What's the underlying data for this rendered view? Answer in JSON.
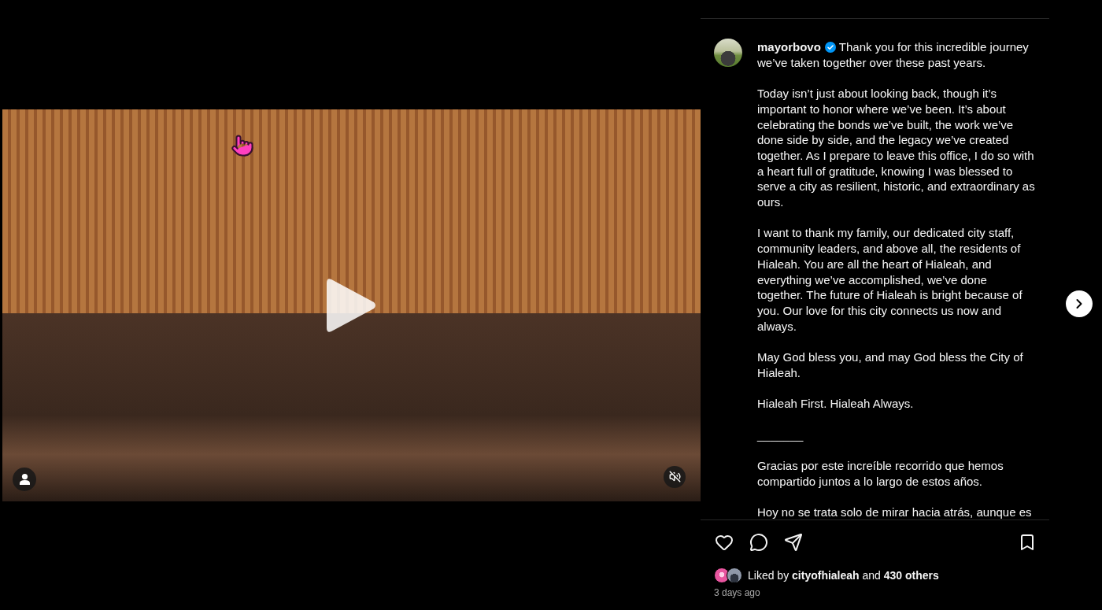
{
  "video": {
    "paused": true,
    "muted": true
  },
  "caption": {
    "username": "mayorbovo",
    "verified": true,
    "paragraphs": [
      "Thank you for this incredible journey we’ve taken together over these past years.",
      "Today isn’t just about looking back, though it’s important to honor where we’ve been. It’s about celebrating the bonds we’ve built, the work we’ve done side by side, and the legacy we’ve created together. As I prepare to leave this office, I do so with a heart full of gratitude, knowing I was blessed to serve a city as resilient, historic, and extraordinary as ours.",
      "I want to thank my family, our dedicated city staff, community leaders, and above all, the residents of Hialeah. You are all the heart of Hialeah, and everything we’ve accomplished, we’ve done together. The future of Hialeah is bright because of you. Our love for this city connects us now and always.",
      "May God bless you, and may God bless the City of Hialeah.",
      "Hialeah First. Hialeah Always.",
      "_______",
      "Gracias por este increíble recorrido que hemos compartido juntos a lo largo de estos años.",
      "Hoy no se trata solo de mirar hacia atrás, aunque es"
    ]
  },
  "actions": {
    "liked": false,
    "saved": false
  },
  "likes": {
    "text": "Liked by **cityofhialeah** and **430 others**"
  },
  "timestamp": "3 days ago"
}
